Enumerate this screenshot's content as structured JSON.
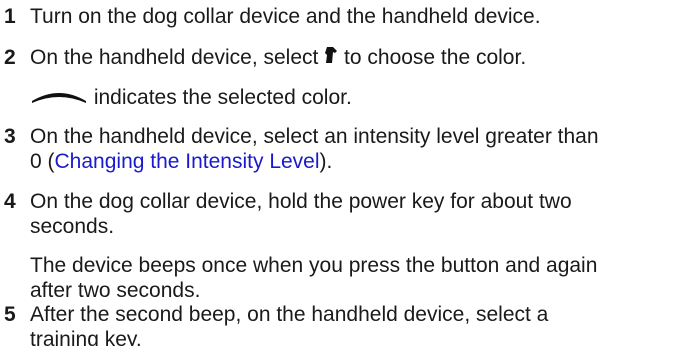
{
  "steps": [
    {
      "number": "1",
      "text": "Turn on the dog collar device and the handheld device."
    },
    {
      "number": "2",
      "text_before": "On the handheld device, select ",
      "icon": "dog-head-icon",
      "text_after": " to choose the color.",
      "note_icon": "color-bar-icon",
      "note": " indicates the selected color."
    },
    {
      "number": "3",
      "line1": "On the handheld device, select an intensity level greater than",
      "line2_before": "0 (",
      "link": "Changing the Intensity Level",
      "line2_after": ")."
    },
    {
      "number": "4",
      "line1": "On the dog collar device, hold the power key for about two",
      "line2": "seconds.",
      "note_line1": "The device beeps once when you press the button and again",
      "note_line2": "after two seconds."
    },
    {
      "number": "5",
      "line1": "After the second beep, on the handheld device, select a",
      "line2": "training key."
    }
  ],
  "colors": {
    "text": "#1a1a1a",
    "link": "#1a1acc"
  }
}
